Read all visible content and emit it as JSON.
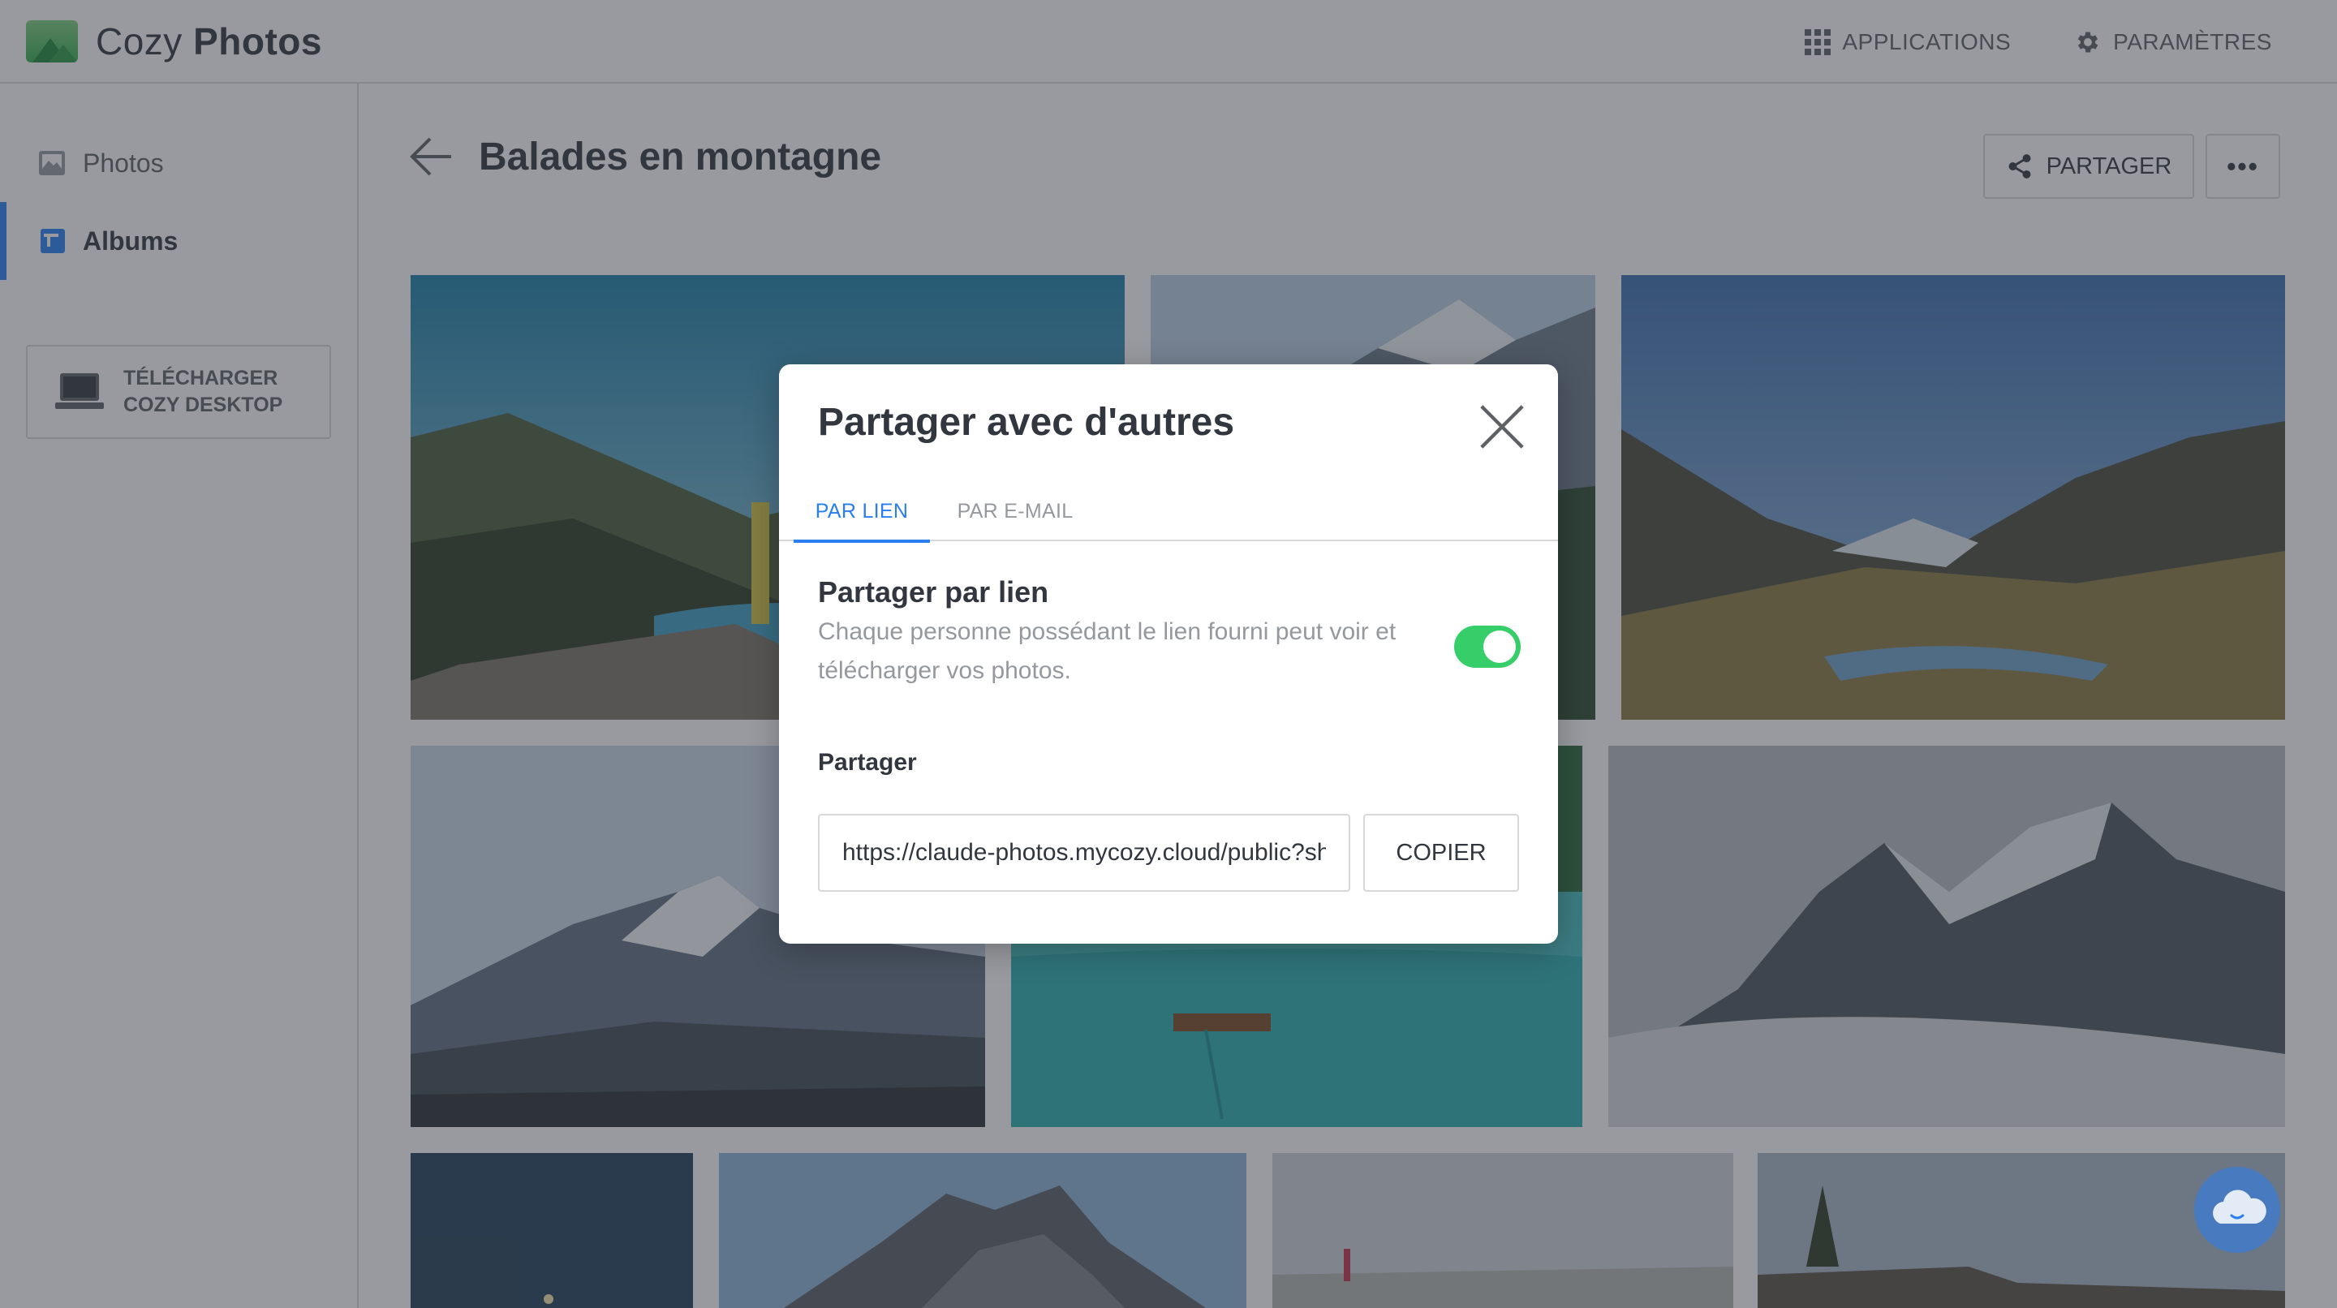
{
  "app": {
    "name_light": "Cozy",
    "name_bold": "Photos",
    "applications_label": "APPLICATIONS",
    "settings_label": "PARAMÈTRES"
  },
  "sidebar": {
    "items": [
      {
        "label": "Photos",
        "icon": "image-icon",
        "active": false
      },
      {
        "label": "Albums",
        "icon": "album-icon",
        "active": true
      }
    ],
    "download": {
      "line1": "TÉLÉCHARGER",
      "line2": "COZY DESKTOP",
      "icon": "laptop-icon"
    }
  },
  "album": {
    "title": "Balades en montagne",
    "share_label": "PARTAGER",
    "more_label": "•••"
  },
  "modal": {
    "title": "Partager avec d'autres",
    "tabs": [
      {
        "label": "PAR LIEN",
        "active": true
      },
      {
        "label": "PAR E-MAIL",
        "active": false
      }
    ],
    "section_title": "Partager par lien",
    "section_desc": "Chaque personne possédant le lien fourni peut voir et télécharger vos photos.",
    "toggle_on": true,
    "field_label": "Partager",
    "link_value": "https://claude-photos.mycozy.cloud/public?sharecode=…",
    "copy_label": "COPIER"
  },
  "colors": {
    "accent": "#297ef2",
    "toggle_on": "#35ce68",
    "text_primary": "#32363f",
    "text_secondary": "#95999d",
    "border": "#d6d8da"
  }
}
